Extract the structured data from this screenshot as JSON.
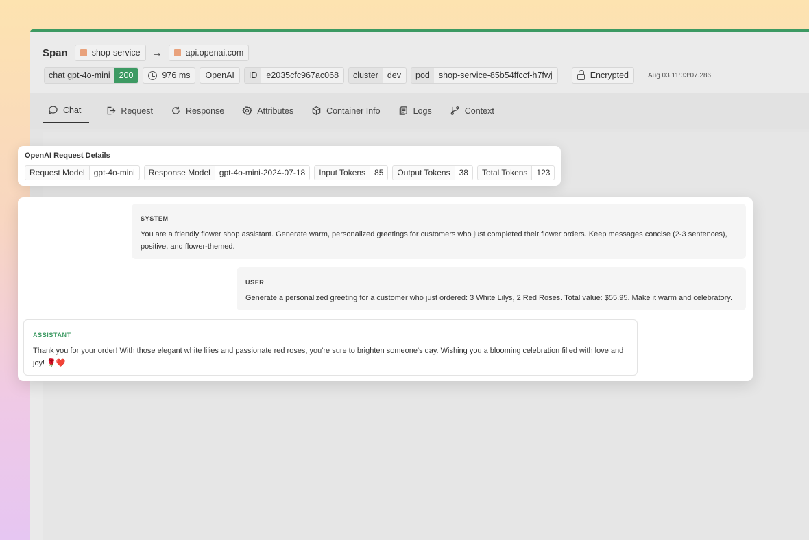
{
  "span": {
    "title": "Span",
    "source": "shop-service",
    "arrow": "→",
    "destination": "api.openai.com"
  },
  "meta": {
    "method_label": "chat gpt-4o-mini",
    "status": "200",
    "duration": "976 ms",
    "provider": "OpenAI",
    "id_label": "ID",
    "id_value": "e2035cfc967ac068",
    "cluster_label": "cluster",
    "cluster_value": "dev",
    "pod_label": "pod",
    "pod_value": "shop-service-85b54ffccf-h7fwj",
    "encrypted": "Encrypted",
    "timestamp": "Aug 03 11:33:07.286"
  },
  "tabs": [
    {
      "label": "Chat",
      "icon": "chat-bubble-icon",
      "active": true
    },
    {
      "label": "Request",
      "icon": "request-icon"
    },
    {
      "label": "Response",
      "icon": "refresh-icon"
    },
    {
      "label": "Attributes",
      "icon": "gear-icon"
    },
    {
      "label": "Container Info",
      "icon": "cube-icon"
    },
    {
      "label": "Logs",
      "icon": "document-icon"
    },
    {
      "label": "Context",
      "icon": "branch-icon"
    }
  ],
  "details": {
    "title": "OpenAI Request Details",
    "items": [
      {
        "key": "Request Model",
        "value": "gpt-4o-mini"
      },
      {
        "key": "Response Model",
        "value": "gpt-4o-mini-2024-07-18"
      },
      {
        "key": "Input Tokens",
        "value": "85"
      },
      {
        "key": "Output Tokens",
        "value": "38"
      },
      {
        "key": "Total Tokens",
        "value": "123"
      }
    ]
  },
  "messages": {
    "system": {
      "role": "SYSTEM",
      "text": "You are a friendly flower shop assistant. Generate warm, personalized greetings for customers who just completed their flower orders. Keep messages concise (2-3 sentences), positive, and flower-themed."
    },
    "user": {
      "role": "USER",
      "text": "Generate a personalized greeting for a customer who just ordered: 3 White Lilys, 2 Red Roses. Total value: $55.95. Make it warm and celebratory."
    },
    "assistant": {
      "role": "ASSISTANT",
      "text": "Thank you for your order! With those elegant white lilies and passionate red roses, you're sure to brighten someone's day. Wishing you a blooming celebration filled with love and joy! 🌹❤️"
    }
  },
  "colors": {
    "accent_green": "#3d9a63",
    "service_square": "#e9a27c"
  }
}
